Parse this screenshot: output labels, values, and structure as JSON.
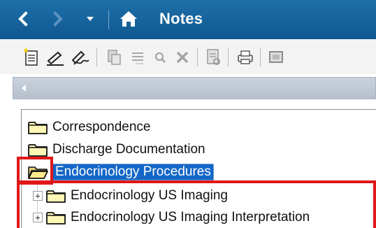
{
  "titlebar": {
    "title": "Notes",
    "back_icon": "chevron-left-icon",
    "forward_icon": "chevron-right-icon",
    "dropdown_icon": "caret-down-icon",
    "home_icon": "home-icon",
    "bg_color": "#15619c"
  },
  "toolbar": {
    "icons": [
      "new-note-icon",
      "sign-icon",
      "forward-sign-icon",
      "attach-icon",
      "list-icon",
      "search-icon",
      "delete-icon",
      "document-icon",
      "print-icon",
      "image-icon"
    ]
  },
  "tree": {
    "items": [
      {
        "label": "Correspondence",
        "state": "closed"
      },
      {
        "label": "Discharge Documentation",
        "state": "closed"
      },
      {
        "label": "Endocrinology Procedures",
        "state": "open",
        "selected": true
      },
      {
        "label": "Endocrinology US Imaging",
        "state": "closed",
        "child": true
      },
      {
        "label": "Endocrinology US Imaging Interpretation",
        "state": "closed",
        "child": true
      }
    ],
    "selection_color": "#1466c7",
    "highlight_color": "#e01818"
  }
}
